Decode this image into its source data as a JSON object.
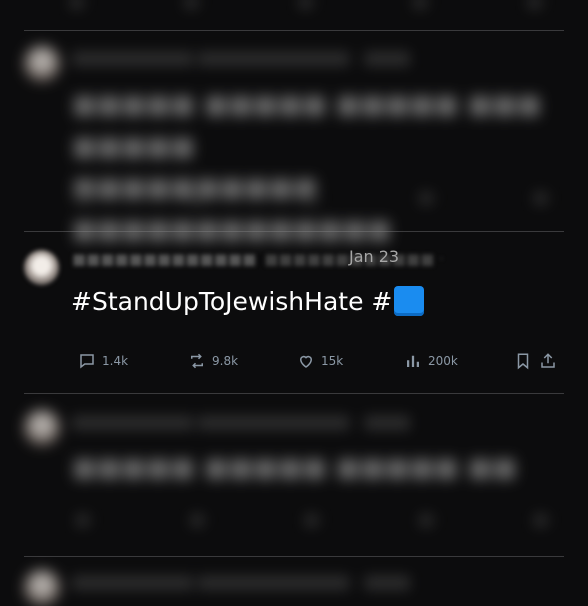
{
  "tweet": {
    "date": "Jan 23",
    "text": "#StandUpToJewishHate #",
    "flag_emoji": "blue-square",
    "metrics": {
      "replies": "1.4k",
      "retweets": "9.8k",
      "likes": "15k",
      "views": "200k"
    }
  },
  "colors": {
    "background": "#0c0c0d",
    "text": "#ffffff",
    "muted": "#8b98a5",
    "divider": "#3a3a3c",
    "flag": "#1a8cf0"
  }
}
